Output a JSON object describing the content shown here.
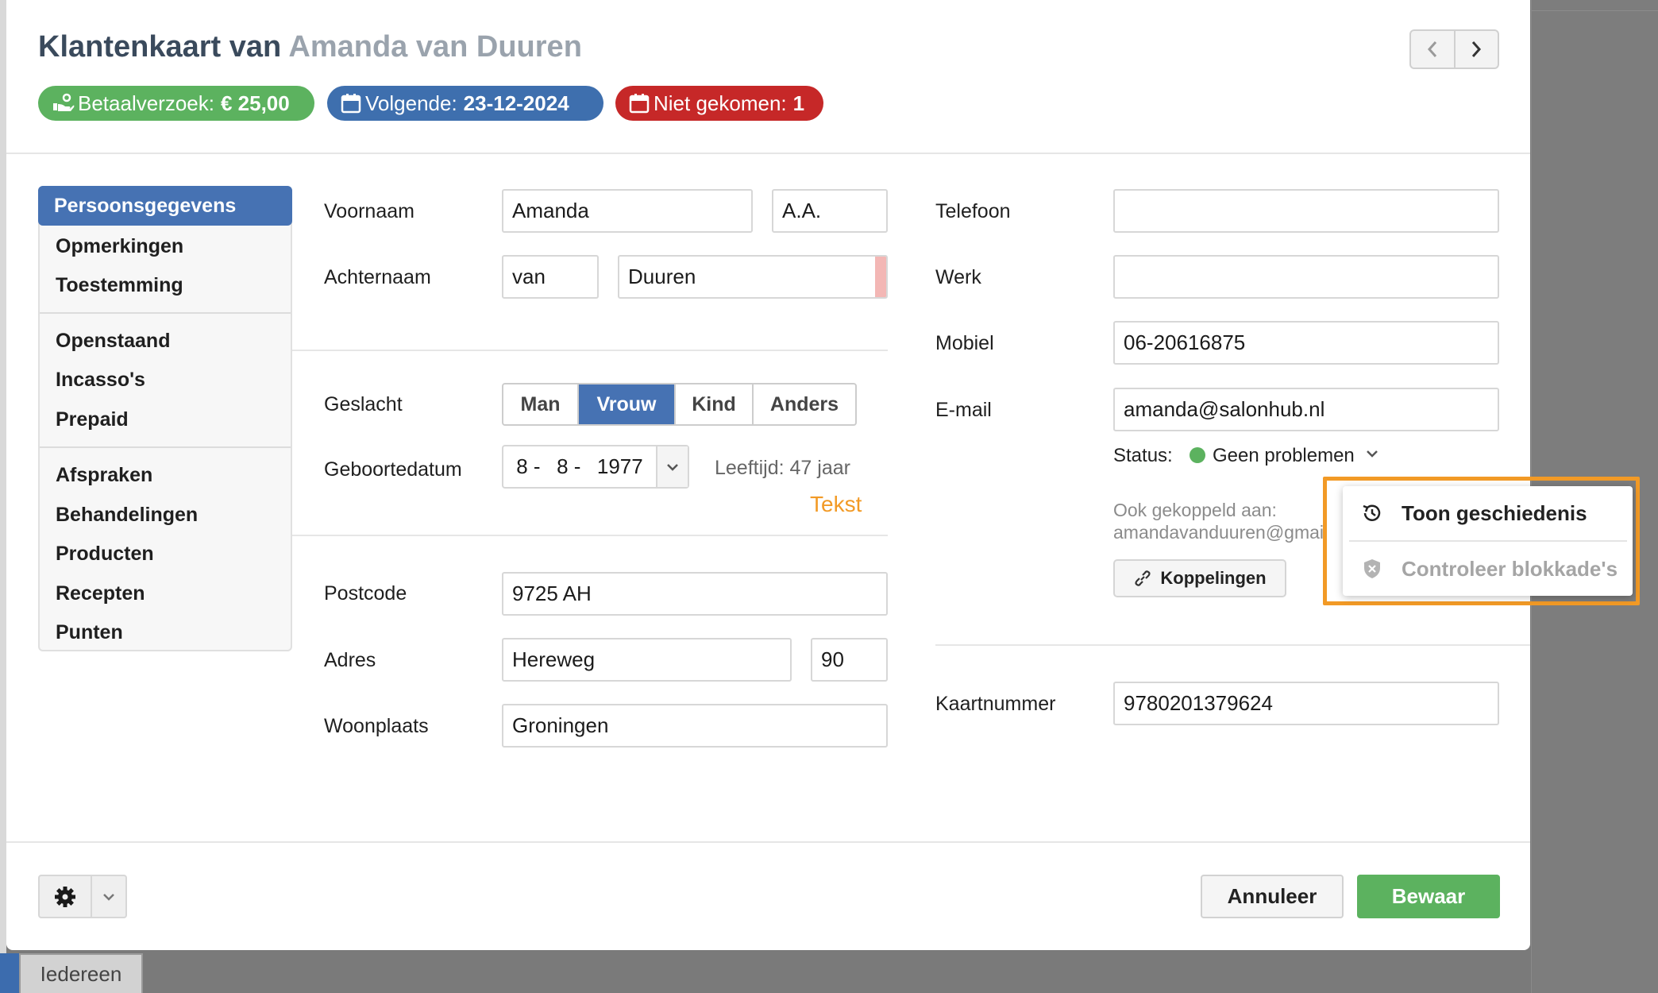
{
  "background": {
    "tab_label": "Iedereen"
  },
  "header": {
    "title_prefix": "Klantenkaart van",
    "client_name": "Amanda van Duuren",
    "prev_icon": "chevron-left-icon",
    "next_icon": "chevron-right-icon"
  },
  "badges": {
    "payment_label": "Betaalverzoek:",
    "payment_value": "€ 25,00",
    "next_label": "Volgende:",
    "next_value": "23-12-2024",
    "noshow_label": "Niet gekomen:",
    "noshow_value": "1",
    "colors": {
      "payment": "#5cb25f",
      "next": "#3e6fae",
      "noshow": "#c62828"
    }
  },
  "sidebar": {
    "items": [
      {
        "label": "Persoonsgegevens",
        "active": true
      },
      {
        "label": "Opmerkingen"
      },
      {
        "label": "Toestemming"
      },
      {
        "label": "Openstaand"
      },
      {
        "label": "Incasso's"
      },
      {
        "label": "Prepaid"
      },
      {
        "label": "Afspraken"
      },
      {
        "label": "Behandelingen"
      },
      {
        "label": "Producten"
      },
      {
        "label": "Recepten"
      },
      {
        "label": "Punten"
      }
    ]
  },
  "form": {
    "voornaam_label": "Voornaam",
    "voornaam": "Amanda",
    "initialen": "A.A.",
    "achternaam_label": "Achternaam",
    "tussenvoegsel": "van",
    "achternaam": "Duuren",
    "geslacht_label": "Geslacht",
    "geslacht_options": [
      "Man",
      "Vrouw",
      "Kind",
      "Anders"
    ],
    "geslacht_selected": "Vrouw",
    "geboortedatum_label": "Geboortedatum",
    "geboorte_dag": "8 -",
    "geboorte_maand": "8 -",
    "geboorte_jaar": "1977",
    "leeftijd": "Leeftijd: 47 jaar",
    "tekst_link": "Tekst",
    "postcode_label": "Postcode",
    "postcode": "9725 AH",
    "adres_label": "Adres",
    "straat": "Hereweg",
    "huisnummer": "90",
    "woonplaats_label": "Woonplaats",
    "woonplaats": "Groningen"
  },
  "contact": {
    "telefoon_label": "Telefoon",
    "telefoon": "",
    "werk_label": "Werk",
    "werk": "",
    "mobiel_label": "Mobiel",
    "mobiel": "06-20616875",
    "email_label": "E-mail",
    "email": "amanda@salonhub.nl",
    "status_label": "Status:",
    "status_value": "Geen problemen",
    "status_color": "#5cb25f",
    "ook_label": "Ook gekoppeld aan:",
    "ook_value": "amandavanduuren@gmail",
    "koppelingen_label": "Koppelingen",
    "kaartnummer_label": "Kaartnummer",
    "kaartnummer": "9780201379624"
  },
  "status_menu": {
    "items": [
      {
        "label": "Toon geschiedenis",
        "icon": "history-icon",
        "enabled": true
      },
      {
        "label": "Controleer blokkade's",
        "icon": "shield-icon",
        "enabled": false
      }
    ],
    "highlight_color": "#f29a26"
  },
  "footer": {
    "settings_icon": "gear-icon",
    "cancel_label": "Annuleer",
    "save_label": "Bewaar"
  }
}
